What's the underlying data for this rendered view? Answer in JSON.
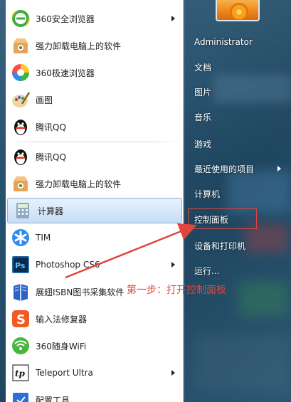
{
  "programs": [
    {
      "label": "360安全浏览器",
      "icon": "360-safe-browser-icon",
      "has_submenu": true
    },
    {
      "label": "强力卸载电脑上的软件",
      "icon": "uninstaller-box-icon",
      "has_submenu": false
    },
    {
      "label": "360极速浏览器",
      "icon": "360-speed-browser-icon",
      "has_submenu": false
    },
    {
      "label": "画图",
      "icon": "paint-palette-icon",
      "has_submenu": false
    },
    {
      "label": "腾讯QQ",
      "icon": "qq-penguin-icon",
      "has_submenu": false
    },
    {
      "label": "腾讯QQ",
      "icon": "qq-penguin-icon",
      "has_submenu": false
    },
    {
      "label": "强力卸载电脑上的软件",
      "icon": "uninstaller-box-icon",
      "has_submenu": false
    },
    {
      "label": "计算器",
      "icon": "calculator-icon",
      "has_submenu": false
    },
    {
      "label": "TIM",
      "icon": "tim-star-icon",
      "has_submenu": false
    },
    {
      "label": "Photoshop CS6",
      "icon": "photoshop-icon",
      "has_submenu": true
    },
    {
      "label": "展翅ISBN图书采集软件",
      "icon": "book-icon",
      "has_submenu": false
    },
    {
      "label": "输入法修复器",
      "icon": "sogou-s-icon",
      "has_submenu": false
    },
    {
      "label": "360随身WiFi",
      "icon": "wifi-icon",
      "has_submenu": false
    },
    {
      "label": "Teleport Ultra",
      "icon": "teleport-tp-icon",
      "has_submenu": true
    },
    {
      "label": "配置工具",
      "icon": "config-tool-icon",
      "has_submenu": false
    }
  ],
  "selected_program_index": 7,
  "right_links": [
    {
      "label": "Administrator",
      "has_submenu": false
    },
    {
      "label": "文档",
      "has_submenu": false
    },
    {
      "label": "图片",
      "has_submenu": false
    },
    {
      "label": "音乐",
      "has_submenu": false
    },
    {
      "label": "游戏",
      "has_submenu": false
    },
    {
      "label": "最近使用的项目",
      "has_submenu": true
    },
    {
      "label": "计算机",
      "has_submenu": false
    },
    {
      "label": "控制面板",
      "has_submenu": false
    },
    {
      "label": "设备和打印机",
      "has_submenu": false
    },
    {
      "label": "运行...",
      "has_submenu": false
    }
  ],
  "highlighted_right_index": 7,
  "annotation": {
    "text": "第一步：打开控制面板"
  },
  "colors": {
    "annotation_red": "#e2453c",
    "selection_blue": "#c7def5",
    "glass_blue": "#25506d"
  }
}
